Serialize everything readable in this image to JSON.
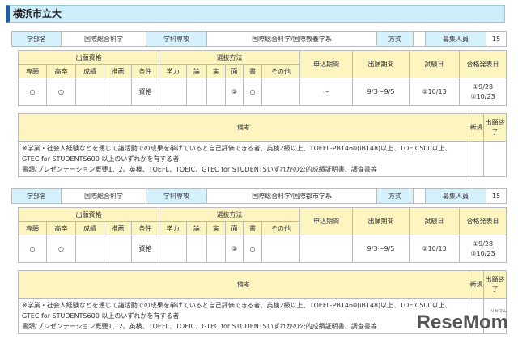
{
  "title": "横浜市立大",
  "labels": {
    "faculty": "学部名",
    "department": "学科専攻",
    "method": "方式",
    "capacity": "募集人員",
    "qual": "出願資格",
    "selection": "選抜方法",
    "apply_period": "申込期間",
    "app_period": "出願期間",
    "exam_date": "試験日",
    "result_date": "合格発表日",
    "sub": [
      "専願",
      "高卒",
      "成績",
      "推薦",
      "条件",
      "学力",
      "論",
      "実",
      "面",
      "書",
      "その他"
    ],
    "remarks": "備考",
    "new": "新規",
    "closed": "出願終了"
  },
  "blocks": [
    {
      "faculty": "国際総合科学",
      "department": "国際総合科学/国際教養学系",
      "method": "",
      "capacity": "15",
      "row": [
        "○",
        "○",
        "",
        "",
        "資格",
        "",
        "",
        "",
        "②",
        "○",
        "",
        "～",
        "9/3～9/5",
        "②10/13"
      ],
      "result1": "①9/28",
      "result2": "②10/23",
      "note1": "※学業・社会人経験などを通じて諸活動での成果を挙げていると自己評価できる者、英検2級以上、TOEFL-PBT460(iBT48)以上、TOEIC500以上、GTEC for STUDENTS600 以上のいずれかを有する者",
      "note2": "書類/プレゼンテーション概要1、2。英検、TOEFL、TOEIC、GTEC for STUDENTSいずれかの公的成績証明書、調査書等"
    },
    {
      "faculty": "国際総合科学",
      "department": "国際総合科学/国際都市学系",
      "method": "",
      "capacity": "15",
      "row": [
        "○",
        "○",
        "",
        "",
        "資格",
        "",
        "",
        "",
        "②",
        "○",
        "",
        "",
        "9/3～9/5",
        "②10/13"
      ],
      "result1": "①9/28",
      "result2": "②10/23",
      "note1": "※学業・社会人経験などを通じて諸活動での成果を挙げていると自己評価できる者、英検2級以上、TOEFL-PBT460(iBT48)以上、TOEIC500以上、GTEC for STUDENTS600 以上のいずれかを有する者",
      "note2": "書類/プレゼンテーション概要1、2。英検、TOEFL、TOEIC、GTEC for STUDENTSいずれかの公的成績証明書、調査書等"
    }
  ],
  "logo": "ReseMom"
}
